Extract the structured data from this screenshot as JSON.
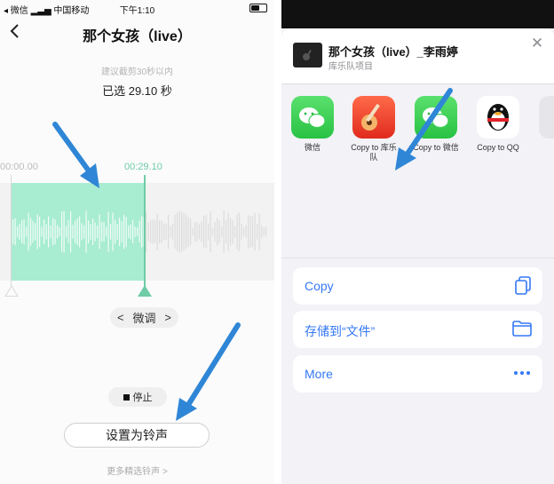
{
  "status_bar": {
    "left": "◂ 微信 ▂▃▅ 中国移动",
    "time": "下午1:10"
  },
  "editor": {
    "title": "那个女孩（live）",
    "hint": "建议截剪30秒以内",
    "selected": "已选 29.10 秒",
    "time_start": "00:00.00",
    "time_end": "00:29.10",
    "fine_tune": "微调",
    "fine_prev": "<",
    "fine_next": ">",
    "stop": "停止",
    "set_ringtone": "设置为铃声",
    "more_ringtones": "更多精选铃声 >"
  },
  "share_sheet": {
    "song_title": "那个女孩（live）_李雨婷",
    "song_subtitle": "库乐队项目",
    "close": "✕",
    "apps": [
      {
        "label": "微信",
        "icon": "wechat-icon"
      },
      {
        "label": "Copy to 库乐队",
        "icon": "garageband-icon"
      },
      {
        "label": "Copy to 微信",
        "icon": "wechat-icon"
      },
      {
        "label": "Copy to QQ",
        "icon": "qq-icon"
      }
    ],
    "actions": [
      {
        "label": "Copy",
        "icon": "copy-icon"
      },
      {
        "label": "存储到“文件”",
        "icon": "folder-icon"
      },
      {
        "label": "More",
        "icon": "more-icon"
      }
    ]
  },
  "colors": {
    "accent_green": "#6fcca7",
    "selection_fill": "#a8ecd2",
    "ios_blue": "#3478f6",
    "arrow_blue": "#2f86d6"
  }
}
